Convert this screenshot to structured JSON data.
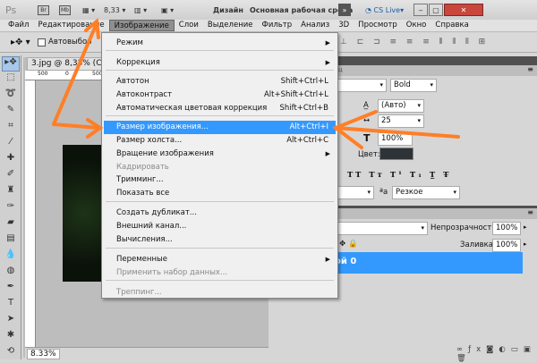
{
  "titlebar": {
    "logo": "Ps",
    "br": "Br",
    "mb": "Mb",
    "zoom": "8,33",
    "workspace_design": "Дизайн",
    "workspace_main": "Основная рабочая среда",
    "cs_live": "CS Live"
  },
  "menubar": [
    "Файл",
    "Редактирование",
    "Изображение",
    "Слои",
    "Выделение",
    "Фильтр",
    "Анализ",
    "3D",
    "Просмотр",
    "Окно",
    "Справка"
  ],
  "options": {
    "autoselect": "Автовыбор"
  },
  "document": {
    "tab": "3.jpg @ 8,33% (С",
    "ruler_top": [
      "500",
      "0",
      "500"
    ],
    "zoom_status": "8.33%"
  },
  "menu": [
    {
      "label": "Режим",
      "submenu": true
    },
    {
      "label": "Коррекция",
      "submenu": true
    },
    {
      "label": "Автотон",
      "shortcut": "Shift+Ctrl+L"
    },
    {
      "label": "Автоконтраст",
      "shortcut": "Alt+Shift+Ctrl+L"
    },
    {
      "label": "Автоматическая цветовая коррекция",
      "shortcut": "Shift+Ctrl+B"
    },
    {
      "label": "Размер изображения...",
      "shortcut": "Alt+Ctrl+I",
      "highlighted": true
    },
    {
      "label": "Размер холста...",
      "shortcut": "Alt+Ctrl+C"
    },
    {
      "label": "Вращение изображения",
      "submenu": true
    },
    {
      "label": "Кадрировать",
      "disabled": true
    },
    {
      "label": "Тримминг..."
    },
    {
      "label": "Показать все"
    },
    {
      "label": "Создать дубликат..."
    },
    {
      "label": "Внешний канал..."
    },
    {
      "label": "Вычисления..."
    },
    {
      "label": "Переменные",
      "submenu": true
    },
    {
      "label": "Применить набор данных...",
      "disabled": true
    },
    {
      "label": "Треппинг...",
      "disabled": true
    }
  ],
  "character": {
    "tab": "зац",
    "font_style": "Bold",
    "leading": "(Авто)",
    "tracking": "25",
    "scale": "100%",
    "color_label": "Цвет:",
    "antialias": "Резкое",
    "color": "#2e3338"
  },
  "layers": {
    "tab": "ы",
    "opacity_label": "Непрозрачность:",
    "opacity": "100%",
    "fill_label": "Заливка:",
    "fill": "100%",
    "layer_name": "ой 0"
  },
  "colors": {
    "highlight": "#3399ff",
    "annotation": "#ff7f27"
  }
}
